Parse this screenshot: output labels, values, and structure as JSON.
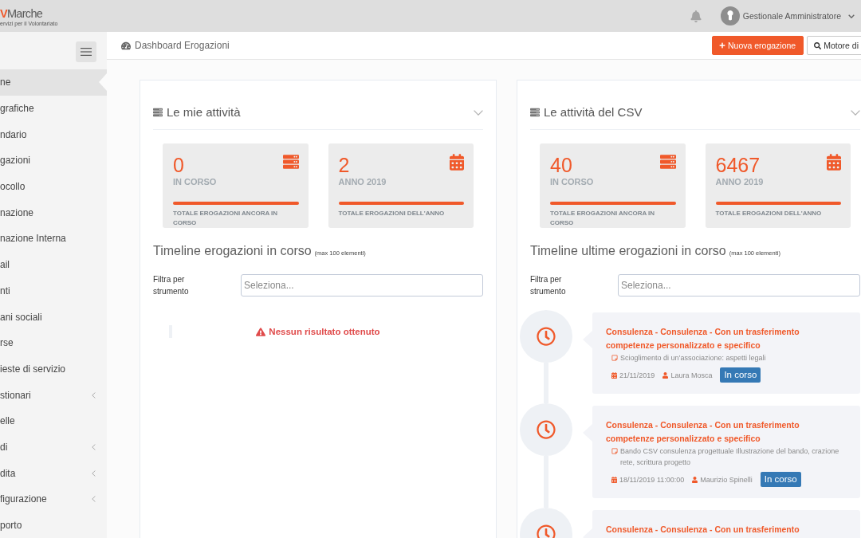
{
  "header": {
    "logo": {
      "accent": "V",
      "name": "Marche",
      "tagline": "ervizi per il Volontariato"
    },
    "user": "Gestionale Amministratore"
  },
  "sidebar": {
    "items": [
      {
        "label": "ne",
        "selected": true,
        "submenu": false
      },
      {
        "label": "grafiche",
        "selected": false,
        "submenu": false
      },
      {
        "label": "ndario",
        "selected": false,
        "submenu": false
      },
      {
        "label": "gazioni",
        "selected": false,
        "submenu": false
      },
      {
        "label": "ocollo",
        "selected": false,
        "submenu": false
      },
      {
        "label": "nazione",
        "selected": false,
        "submenu": false
      },
      {
        "label": "nazione Interna",
        "selected": false,
        "submenu": false
      },
      {
        "label": "ail",
        "selected": false,
        "submenu": false
      },
      {
        "label": "nti",
        "selected": false,
        "submenu": false
      },
      {
        "label": "ani sociali",
        "selected": false,
        "submenu": false
      },
      {
        "label": "rse",
        "selected": false,
        "submenu": false
      },
      {
        "label": "ieste di servizio",
        "selected": false,
        "submenu": false
      },
      {
        "label": "stionari",
        "selected": false,
        "submenu": true
      },
      {
        "label": "elle",
        "selected": false,
        "submenu": false
      },
      {
        "label": "di",
        "selected": false,
        "submenu": true
      },
      {
        "label": "dita",
        "selected": false,
        "submenu": true
      },
      {
        "label": "figurazione",
        "selected": false,
        "submenu": true
      },
      {
        "label": "porto",
        "selected": false,
        "submenu": false
      }
    ]
  },
  "page_header": {
    "title": "Dashboard Erogazioni",
    "actions": [
      {
        "kind": "create",
        "label": "Nuova erogazione"
      },
      {
        "kind": "search",
        "label": "Motore di"
      }
    ]
  },
  "panels": [
    {
      "title": "Le mie attività",
      "stats": [
        {
          "kind": "running",
          "value": "0",
          "label": "IN CORSO",
          "caption": "TOTALE EROGAZIONI ANCORA IN CORSO"
        },
        {
          "kind": "year",
          "value": "2",
          "label": "ANNO 2019",
          "caption": "TOTALE EROGAZIONI DELL'ANNO"
        }
      ],
      "timeline": {
        "title": "Timeline erogazioni in corso",
        "note": "(max 100 elementi)",
        "filter_label": "Filtra per strumento",
        "placeholder": "Seleziona...",
        "empty_message": "Nessun risultato ottenuto"
      }
    },
    {
      "title": "Le attività del CSV",
      "stats": [
        {
          "kind": "running",
          "value": "40",
          "label": "IN CORSO",
          "caption": "TOTALE EROGAZIONI ANCORA IN CORSO"
        },
        {
          "kind": "year",
          "value": "6467",
          "label": "ANNO 2019",
          "caption": "TOTALE EROGAZIONI DELL'ANNO"
        }
      ],
      "timeline": {
        "title": "Timeline ultime erogazioni in corso",
        "note": "(max 100 elementi)",
        "filter_label": "Filtra per strumento",
        "placeholder": "Seleziona...",
        "items": [
          {
            "title": "Consulenza - Consulenza - Con un trasferimento competenze personalizzato e specifico",
            "description": "Scioglimento di un’associazione: aspetti legali",
            "date": "21/11/2019",
            "person": "Laura Mosca",
            "status": "In corso"
          },
          {
            "title": "Consulenza - Consulenza - Con un trasferimento competenze personalizzato e specifico",
            "description": "Bando CSV consulenza progettuale Illustrazione del bando, crazione rete, scrittura progetto",
            "date": "18/11/2019 11:00:00",
            "person": "Maurizio Spinelli",
            "status": "In corso"
          },
          {
            "title": "Consulenza - Consulenza - Con un trasferimento"
          }
        ]
      }
    }
  ]
}
